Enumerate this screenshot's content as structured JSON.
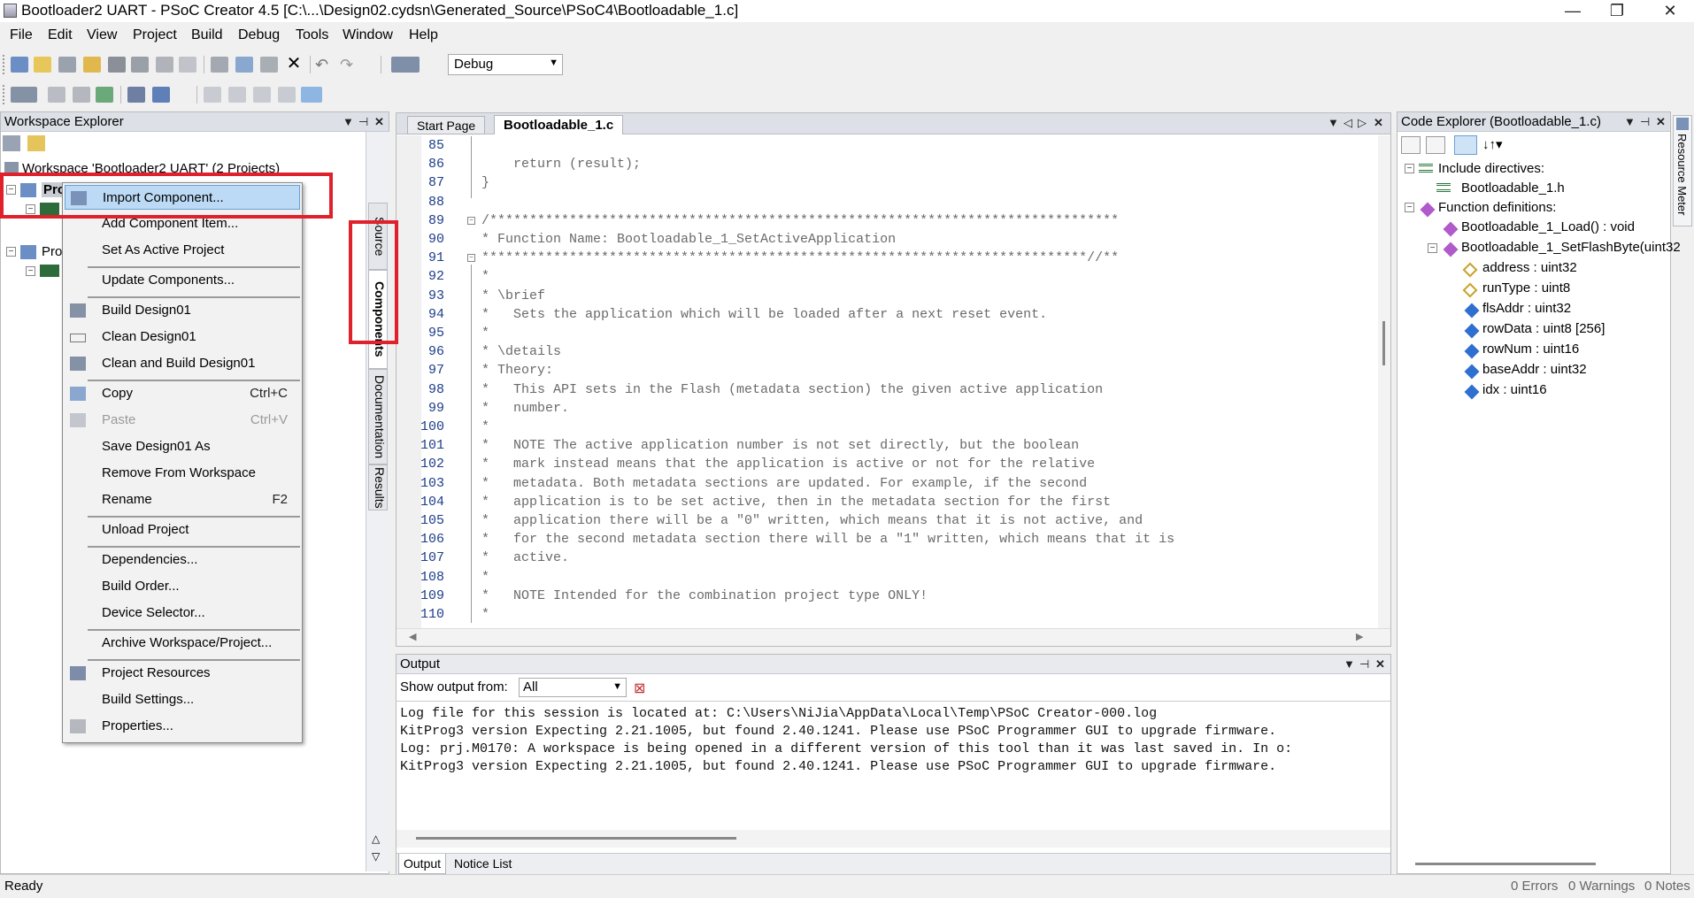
{
  "window": {
    "title": "Bootloader2 UART - PSoC Creator 4.5  [C:\\...\\Design02.cydsn\\Generated_Source\\PSoC4\\Bootloadable_1.c]",
    "minimize": "—",
    "maximize": "❐",
    "close": "✕"
  },
  "menu": [
    "File",
    "Edit",
    "View",
    "Project",
    "Build",
    "Debug",
    "Tools",
    "Window",
    "Help"
  ],
  "toolbar": {
    "config_combo": "Debug"
  },
  "workspace_explorer": {
    "title": "Workspace Explorer",
    "workspace_label": "Workspace 'Bootloader2 UART' (2 Projects)",
    "project1_label": "Pro",
    "project2_label": "Pro"
  },
  "side_tabs": {
    "source": "Source",
    "components": "Components",
    "documentation": "Documentation",
    "results": "Results"
  },
  "context_menu": {
    "items": [
      {
        "label": "Import Component...",
        "shortcut": ""
      },
      {
        "label": "Add Component Item...",
        "shortcut": ""
      },
      {
        "label": "Set As Active Project",
        "shortcut": ""
      },
      {
        "label": "Update Components...",
        "shortcut": ""
      },
      {
        "label": "Build Design01",
        "shortcut": ""
      },
      {
        "label": "Clean Design01",
        "shortcut": ""
      },
      {
        "label": "Clean and Build Design01",
        "shortcut": ""
      },
      {
        "label": "Copy",
        "shortcut": "Ctrl+C"
      },
      {
        "label": "Paste",
        "shortcut": "Ctrl+V"
      },
      {
        "label": "Save Design01 As",
        "shortcut": ""
      },
      {
        "label": "Remove From Workspace",
        "shortcut": ""
      },
      {
        "label": "Rename",
        "shortcut": "F2"
      },
      {
        "label": "Unload Project",
        "shortcut": ""
      },
      {
        "label": "Dependencies...",
        "shortcut": ""
      },
      {
        "label": "Build Order...",
        "shortcut": ""
      },
      {
        "label": "Device Selector...",
        "shortcut": ""
      },
      {
        "label": "Archive Workspace/Project...",
        "shortcut": ""
      },
      {
        "label": "Project Resources",
        "shortcut": ""
      },
      {
        "label": "Build Settings...",
        "shortcut": ""
      },
      {
        "label": "Properties...",
        "shortcut": ""
      }
    ]
  },
  "editor": {
    "tabs": [
      {
        "label": "Start Page"
      },
      {
        "label": "Bootloadable_1.c"
      }
    ],
    "lines": [
      {
        "n": "85",
        "t": ""
      },
      {
        "n": "86",
        "t": "    return (result);"
      },
      {
        "n": "87",
        "t": "}"
      },
      {
        "n": "88",
        "t": ""
      },
      {
        "n": "89",
        "t": "/*******************************************************************************"
      },
      {
        "n": "90",
        "t": "* Function Name: Bootloadable_1_SetActiveApplication"
      },
      {
        "n": "91",
        "t": "****************************************************************************//**"
      },
      {
        "n": "92",
        "t": "*"
      },
      {
        "n": "93",
        "t": "* \\brief"
      },
      {
        "n": "94",
        "t": "*   Sets the application which will be loaded after a next reset event."
      },
      {
        "n": "95",
        "t": "*"
      },
      {
        "n": "96",
        "t": "* \\details"
      },
      {
        "n": "97",
        "t": "* Theory:"
      },
      {
        "n": "98",
        "t": "*   This API sets in the Flash (metadata section) the given active application"
      },
      {
        "n": "99",
        "t": "*   number."
      },
      {
        "n": "100",
        "t": "*"
      },
      {
        "n": "101",
        "t": "*   NOTE The active application number is not set directly, but the boolean"
      },
      {
        "n": "102",
        "t": "*   mark instead means that the application is active or not for the relative"
      },
      {
        "n": "103",
        "t": "*   metadata. Both metadata sections are updated. For example, if the second"
      },
      {
        "n": "104",
        "t": "*   application is to be set active, then in the metadata section for the first"
      },
      {
        "n": "105",
        "t": "*   application there will be a \"0\" written, which means that it is not active, and"
      },
      {
        "n": "106",
        "t": "*   for the second metadata section there will be a \"1\" written, which means that it is"
      },
      {
        "n": "107",
        "t": "*   active."
      },
      {
        "n": "108",
        "t": "*"
      },
      {
        "n": "109",
        "t": "*   NOTE Intended for the combination project type ONLY!"
      },
      {
        "n": "110",
        "t": "*"
      }
    ]
  },
  "output": {
    "title": "Output",
    "show_from_label": "Show output from:",
    "show_from_value": "All",
    "lines": [
      "Log file for this session is located at: C:\\Users\\NiJia\\AppData\\Local\\Temp\\PSoC Creator-000.log",
      "KitProg3 version Expecting 2.21.1005, but found 2.40.1241. Please use PSoC Programmer GUI to upgrade firmware.",
      "Log: prj.M0170: A workspace is being opened in a different version of this tool than it was last saved in. In o:",
      "KitProg3 version Expecting 2.21.1005, but found 2.40.1241. Please use PSoC Programmer GUI to upgrade firmware."
    ],
    "tabs": [
      "Output",
      "Notice List"
    ]
  },
  "code_explorer": {
    "title": "Code Explorer (Bootloadable_1.c)",
    "include_label": "Include directives:",
    "include_file": "Bootloadable_1.h",
    "function_label": "Function definitions:",
    "func1": "Bootloadable_1_Load() : void",
    "func2": "Bootloadable_1_SetFlashByte(uint32",
    "params": [
      "address : uint32",
      "runType : uint8",
      "flsAddr : uint32",
      "rowData : uint8 [256]",
      "rowNum : uint16",
      "baseAddr : uint32",
      "idx : uint16"
    ]
  },
  "resource_meter": "Resource Meter",
  "status": {
    "ready": "Ready",
    "errors": "0 Errors",
    "warnings": "0 Warnings",
    "notes": "0 Notes"
  },
  "colors": {
    "highlight_red": "#e0202a",
    "menu_highlight": "#bcdaf5",
    "line_number_blue": "#1c3d8a"
  }
}
